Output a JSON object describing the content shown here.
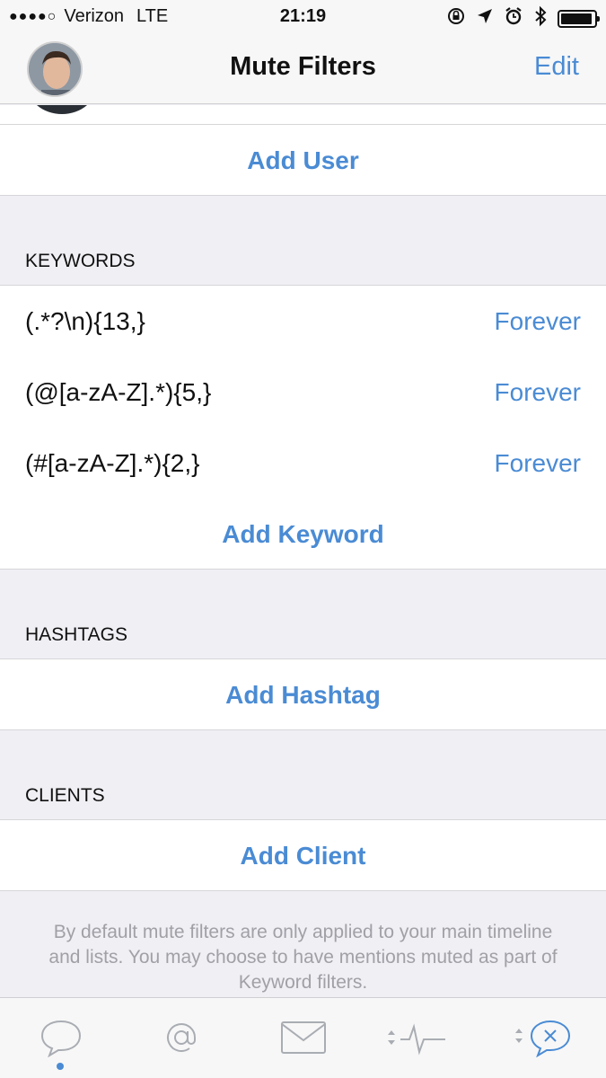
{
  "status_bar": {
    "signal_dots": "●●●●○",
    "carrier": "Verizon",
    "network": "LTE",
    "time": "21:19",
    "battery_level": 0.95
  },
  "nav": {
    "title": "Mute Filters",
    "edit_label": "Edit"
  },
  "users_section": {
    "add_label": "Add User"
  },
  "keywords_section": {
    "header": "KEYWORDS",
    "items": [
      {
        "pattern": "(.*?\\n){13,}",
        "duration": "Forever"
      },
      {
        "pattern": "(@[a-zA-Z].*){5,}",
        "duration": "Forever"
      },
      {
        "pattern": "(#[a-zA-Z].*){2,}",
        "duration": "Forever"
      }
    ],
    "add_label": "Add Keyword"
  },
  "hashtags_section": {
    "header": "HASHTAGS",
    "add_label": "Add Hashtag"
  },
  "clients_section": {
    "header": "CLIENTS",
    "add_label": "Add Client"
  },
  "footer_note": "By default mute filters are only applied to your main timeline and lists. You may choose to have mentions muted as part of Keyword filters.",
  "tabs": [
    {
      "icon": "speech-bubble-icon",
      "selected": true
    },
    {
      "icon": "at-sign-icon",
      "selected": false
    },
    {
      "icon": "envelope-icon",
      "selected": false
    },
    {
      "icon": "activity-icon",
      "selected": false
    },
    {
      "icon": "mute-bubble-icon",
      "selected": false
    }
  ],
  "colors": {
    "accent": "#4a8bd4",
    "background": "#efeff4",
    "row": "#ffffff",
    "footer_text": "#a0a0a6"
  }
}
